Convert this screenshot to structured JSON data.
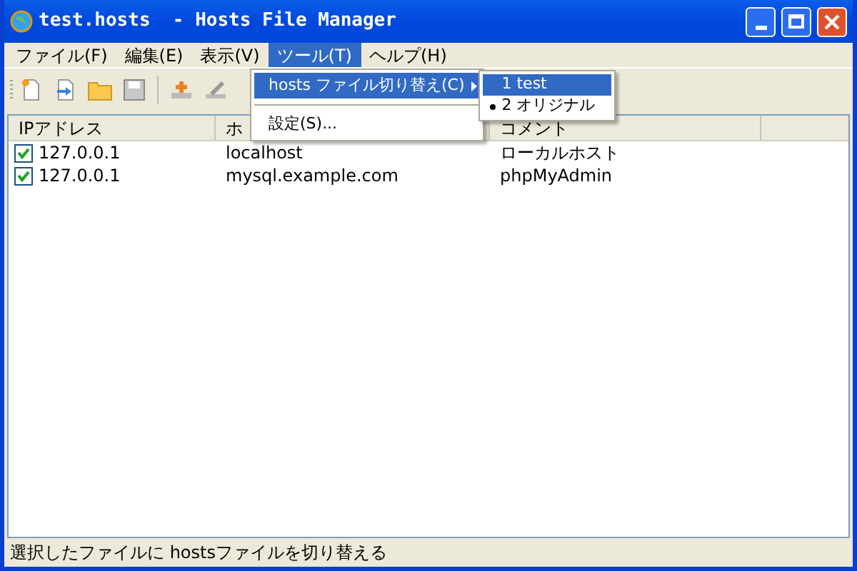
{
  "window": {
    "title": "test.hosts  - Hosts File Manager"
  },
  "menu_bar": [
    {
      "label": "ファイル(F)",
      "selected": false
    },
    {
      "label": "編集(E)",
      "selected": false
    },
    {
      "label": "表示(V)",
      "selected": false
    },
    {
      "label": "ツール(T)",
      "selected": true
    },
    {
      "label": "ヘルプ(H)",
      "selected": false
    }
  ],
  "open_menu": {
    "items": [
      {
        "kind": "submenu",
        "label": "hosts ファイル切り替え(C)",
        "selected": true
      },
      {
        "kind": "separator"
      },
      {
        "kind": "item",
        "label": "設定(S)...",
        "selected": false
      }
    ]
  },
  "submenu": {
    "items": [
      {
        "label": "1 test",
        "selected": true,
        "checked": false
      },
      {
        "label": "2 オリジナル",
        "selected": false,
        "checked": true
      }
    ]
  },
  "table": {
    "columns": [
      "IPアドレス",
      "ホ",
      "コメント"
    ],
    "rows": [
      {
        "checked": true,
        "cells": [
          "127.0.0.1",
          "localhost",
          "ローカルホスト"
        ]
      },
      {
        "checked": true,
        "cells": [
          "127.0.0.1",
          "mysql.example.com",
          "phpMyAdmin"
        ]
      }
    ]
  },
  "status_bar": "選択したファイルに hostsファイルを切り替える"
}
